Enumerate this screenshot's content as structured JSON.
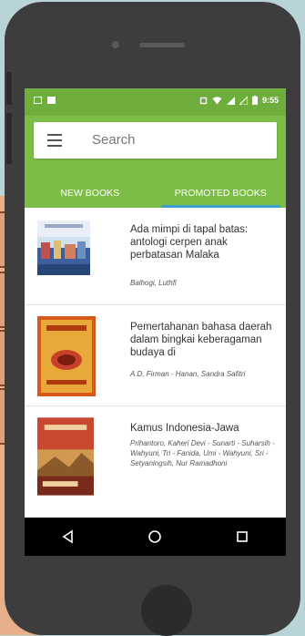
{
  "statusbar": {
    "time": "9:55"
  },
  "search": {
    "placeholder": "Search"
  },
  "tabs": [
    {
      "label": "NEW BOOKS",
      "active": false
    },
    {
      "label": "PROMOTED BOOKS",
      "active": true
    }
  ],
  "books": [
    {
      "title": "Ada mimpi di tapal batas: antologi cerpen anak perbatasan Malaka",
      "author": "Balhogi, Luthfi"
    },
    {
      "title": "Pemertahanan bahasa daerah dalam bingkai keberagaman budaya di",
      "author": "A.D, Firman - Hanan, Sandra Safitri"
    },
    {
      "title": "Kamus Indonesia-Jawa",
      "author": "Prihantoro, Kaheri Devi - Sunarti - Suharsih - Wahyuni, Tri - Fanida, Umi - Wahyuni, Sri - Setyaningsih, Nur Ramadhoni"
    }
  ],
  "colors": {
    "accent": "#7bbd46",
    "tab_indicator": "#3aa0c8"
  },
  "navbar": {
    "icons": [
      "back-icon",
      "home-icon",
      "recents-icon"
    ]
  }
}
